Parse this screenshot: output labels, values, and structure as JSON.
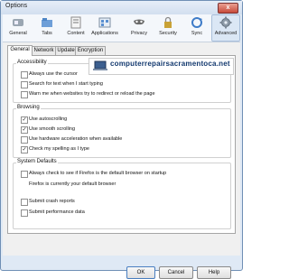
{
  "window": {
    "title": "Options",
    "close_label": "x"
  },
  "toolbar": {
    "items": [
      {
        "label": "General",
        "icon": "general-switch-icon"
      },
      {
        "label": "Tabs",
        "icon": "tabs-icon"
      },
      {
        "label": "Content",
        "icon": "content-icon"
      },
      {
        "label": "Applications",
        "icon": "applications-icon"
      },
      {
        "label": "Privacy",
        "icon": "privacy-mask-icon"
      },
      {
        "label": "Security",
        "icon": "security-lock-icon"
      },
      {
        "label": "Sync",
        "icon": "sync-icon"
      },
      {
        "label": "Advanced",
        "icon": "advanced-gear-icon"
      }
    ],
    "selected": "Advanced"
  },
  "tabs": [
    {
      "label": "General",
      "active": true
    },
    {
      "label": "Network",
      "active": false
    },
    {
      "label": "Update",
      "active": false
    },
    {
      "label": "Encryption",
      "active": false
    }
  ],
  "accessibility": {
    "title": "Accessibility",
    "options": [
      {
        "label": "Always use the cursor",
        "checked": false
      },
      {
        "label": "Search for text when I start typing",
        "checked": false
      },
      {
        "label": "Warn me when websites try to redirect or reload the page",
        "checked": false
      }
    ]
  },
  "browsing": {
    "title": "Browsing",
    "options": [
      {
        "label": "Use autoscrolling",
        "checked": true
      },
      {
        "label": "Use smooth scrolling",
        "checked": true
      },
      {
        "label": "Use hardware acceleration when available",
        "checked": false
      },
      {
        "label": "Check my spelling as I type",
        "checked": true
      }
    ]
  },
  "system_defaults": {
    "title": "System Defaults",
    "always_check": "Always check to see if Firefox is the default browser on startup",
    "status": "Firefox is currently your default browser",
    "crash_reports": "Submit crash reports",
    "performance_data": "Submit performance data"
  },
  "banner": {
    "text": "computerrepairsacramentoca.net",
    "icon": "laptop-icon"
  },
  "buttons": {
    "ok": "OK",
    "cancel": "Cancel",
    "help": "Help"
  },
  "colors": {
    "accent": "#12386e",
    "close": "#c74a3a"
  }
}
